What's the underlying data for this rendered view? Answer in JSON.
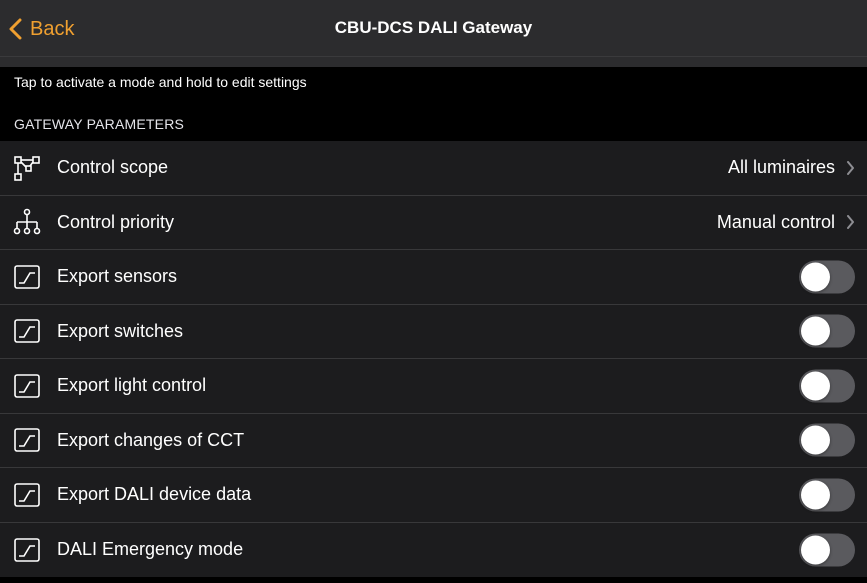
{
  "nav": {
    "back_label": "Back",
    "title": "CBU-DCS DALI Gateway"
  },
  "hint": "Tap to activate a mode and hold to edit settings",
  "section": "GATEWAY PARAMETERS",
  "rows": [
    {
      "label": "Control scope",
      "value": "All luminaires",
      "icon": "branch-nodes-icon"
    },
    {
      "label": "Control priority",
      "value": "Manual control",
      "icon": "hierarchy-icon"
    },
    {
      "label": "Export sensors",
      "toggle": false,
      "icon": "chart-export-icon"
    },
    {
      "label": "Export switches",
      "toggle": false,
      "icon": "chart-export-icon"
    },
    {
      "label": "Export light control",
      "toggle": false,
      "icon": "chart-export-icon"
    },
    {
      "label": "Export changes of CCT",
      "toggle": false,
      "icon": "chart-export-icon"
    },
    {
      "label": "Export DALI device data",
      "toggle": false,
      "icon": "chart-export-icon"
    },
    {
      "label": "DALI Emergency mode",
      "toggle": false,
      "icon": "chart-export-icon"
    }
  ],
  "colors": {
    "accent": "#f0a030",
    "nav_bg": "#2c2c2e",
    "row_bg": "#1c1c1e",
    "toggle_off": "#5a5a5e"
  }
}
